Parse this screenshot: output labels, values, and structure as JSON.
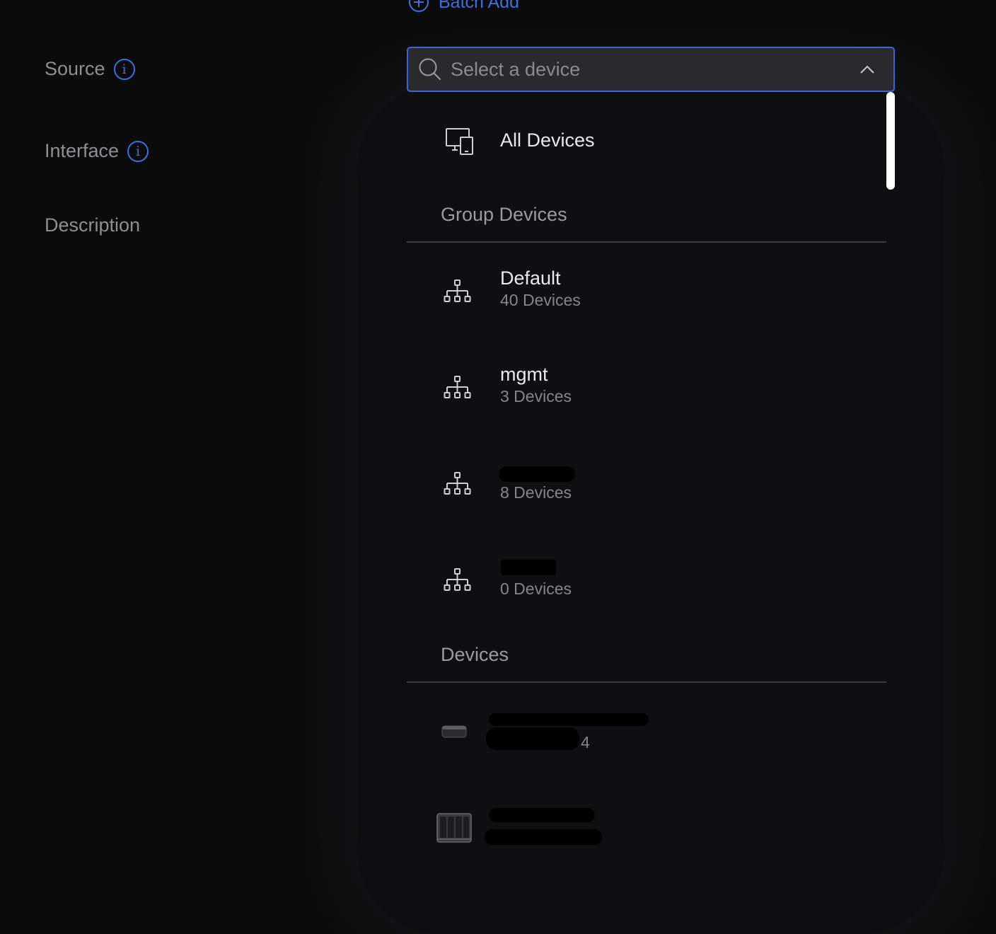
{
  "top_action": {
    "label": "Batch Add"
  },
  "fields": {
    "source_label": "Source",
    "interface_label": "Interface",
    "description_label": "Description"
  },
  "device_select": {
    "placeholder": "Select a device",
    "value": ""
  },
  "dropdown": {
    "all_devices": "All Devices",
    "group_section": "Group Devices",
    "groups": [
      {
        "name": "Default",
        "count": "40 Devices"
      },
      {
        "name": "mgmt",
        "count": "3 Devices"
      },
      {
        "name": "",
        "count": "8 Devices"
      },
      {
        "name": "",
        "count": "0 Devices"
      }
    ],
    "devices_section": "Devices",
    "devices": [
      {
        "name": "",
        "detail": "4"
      },
      {
        "name": "",
        "detail": ""
      }
    ]
  },
  "colors": {
    "accent": "#3d6fe0",
    "background": "#0b0b0c",
    "input_bg": "#2a2a2e",
    "muted_text": "#8e8e93"
  },
  "icons": [
    "plus-circle-icon",
    "info-icon",
    "search-icon",
    "chevron-up-icon",
    "devices-icon",
    "group-hierarchy-icon",
    "apple-tv-device-icon",
    "nas-device-icon"
  ]
}
